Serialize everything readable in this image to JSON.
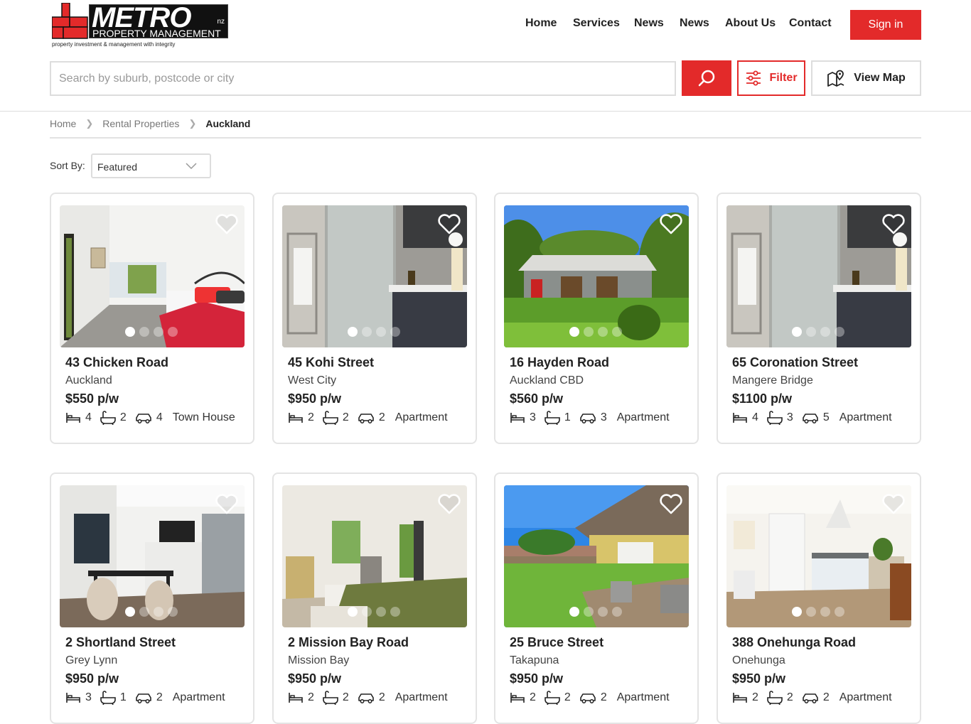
{
  "brand": {
    "name": "METRO",
    "suffix": "nz",
    "subtitle": "PROPERTY MANAGEMENT",
    "tagline": "property investment & management with integrity"
  },
  "nav": {
    "items": [
      "Home",
      "Services",
      "News",
      "News",
      "About Us",
      "Contact"
    ],
    "signin_label": "Sign in"
  },
  "search": {
    "placeholder": "Search by suburb, postcode or city",
    "filter_label": "Filter",
    "map_label": "View Map"
  },
  "breadcrumb": [
    "Home",
    "Rental Properties",
    "Auckland"
  ],
  "sort": {
    "label": "Sort By:",
    "value": "Featured"
  },
  "colors": {
    "accent": "#e32a2a"
  },
  "listings": [
    {
      "address": "43 Chicken Road",
      "suburb": "Auckland",
      "price": "$550 p/w",
      "beds": "4",
      "baths": "2",
      "cars": "4",
      "type": "Town House",
      "image": "bedroom"
    },
    {
      "address": "45 Kohi Street",
      "suburb": "West City",
      "price": "$950 p/w",
      "beds": "2",
      "baths": "2",
      "cars": "2",
      "type": "Apartment",
      "image": "bathroom"
    },
    {
      "address": "16 Hayden Road",
      "suburb": "Auckland CBD",
      "price": "$560 p/w",
      "beds": "3",
      "baths": "1",
      "cars": "3",
      "type": "Apartment",
      "image": "cottage"
    },
    {
      "address": "65 Coronation Street",
      "suburb": "Mangere Bridge",
      "price": "$1100 p/w",
      "beds": "4",
      "baths": "3",
      "cars": "5",
      "type": "Apartment",
      "image": "bathroom"
    },
    {
      "address": "2 Shortland Street",
      "suburb": "Grey Lynn",
      "price": "$950 p/w",
      "beds": "3",
      "baths": "1",
      "cars": "2",
      "type": "Apartment",
      "image": "kitchen"
    },
    {
      "address": "2 Mission Bay Road",
      "suburb": "Mission Bay",
      "price": "$950 p/w",
      "beds": "2",
      "baths": "2",
      "cars": "2",
      "type": "Apartment",
      "image": "bedroom-green"
    },
    {
      "address": "25 Bruce Street",
      "suburb": "Takapuna",
      "price": "$950 p/w",
      "beds": "2",
      "baths": "2",
      "cars": "2",
      "type": "Apartment",
      "image": "house-lawn"
    },
    {
      "address": "388 Onehunga Road",
      "suburb": "Onehunga",
      "price": "$950 p/w",
      "beds": "2",
      "baths": "2",
      "cars": "2",
      "type": "Apartment",
      "image": "open-kitchen"
    }
  ]
}
